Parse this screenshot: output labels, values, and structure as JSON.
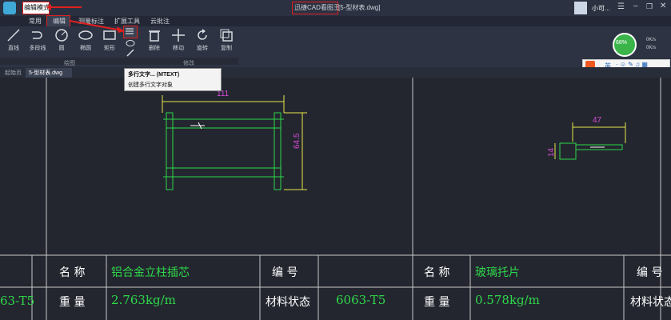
{
  "titlebar": {
    "mode_label": "编辑模式",
    "app_title": "迅捷CAD看图王",
    "file_title": "[5-型材表.dwg]",
    "user_name": "小可..."
  },
  "tabs": [
    {
      "label": "常用"
    },
    {
      "label": "编辑"
    },
    {
      "label": "测量标注"
    },
    {
      "label": "扩展工具"
    },
    {
      "label": "云批注"
    }
  ],
  "draw_tools": [
    {
      "label": "直线",
      "icon": "line-icon"
    },
    {
      "label": "多段线",
      "icon": "polyline-icon"
    },
    {
      "label": "圆",
      "icon": "circle-icon"
    },
    {
      "label": "椭圆",
      "icon": "ellipse-icon"
    },
    {
      "label": "矩形",
      "icon": "rectangle-icon"
    }
  ],
  "modify_tools": [
    {
      "label": "删除",
      "icon": "trash-icon"
    },
    {
      "label": "移动",
      "icon": "move-icon"
    },
    {
      "label": "旋转",
      "icon": "rotate-icon"
    },
    {
      "label": "复制",
      "icon": "copy-icon"
    }
  ],
  "groups": {
    "draw": "绘图",
    "modify": "修改"
  },
  "tooltip": {
    "title": "多行文字... (MTEXT)",
    "desc": "创建多行文字对象"
  },
  "doc_tabs": [
    {
      "label": "起始页"
    },
    {
      "label": "5-型材表.dwg"
    }
  ],
  "network": {
    "percent": "68%",
    "up": "0K/s",
    "down": "0K/s"
  },
  "ime": {
    "lang": "英"
  },
  "drawing": {
    "dims": {
      "left_width": "111",
      "left_height": "64.5",
      "right_width": "47",
      "right_height": "14"
    }
  },
  "table": {
    "row1": {
      "label1": "名 称",
      "value1": "铝合金立柱插芯",
      "label2": "编 号",
      "label3": "名 称",
      "value3": "玻璃托片",
      "label4": "编 号"
    },
    "row2": {
      "left_clip": "63-T5",
      "label1": "重 量",
      "value1": "2.763kg/m",
      "label2": "材料状态",
      "value2": "6063-T5",
      "label3": "重 量",
      "value3": "0.578kg/m",
      "label4": "材料状态"
    }
  },
  "colors": {
    "accent_red": "#e02020",
    "cad_green": "#2ed84a",
    "cad_yellow": "#e8e84a",
    "cad_white": "#ffffff",
    "cad_magenta": "#d84ad8",
    "net_green": "#3bb54a"
  }
}
